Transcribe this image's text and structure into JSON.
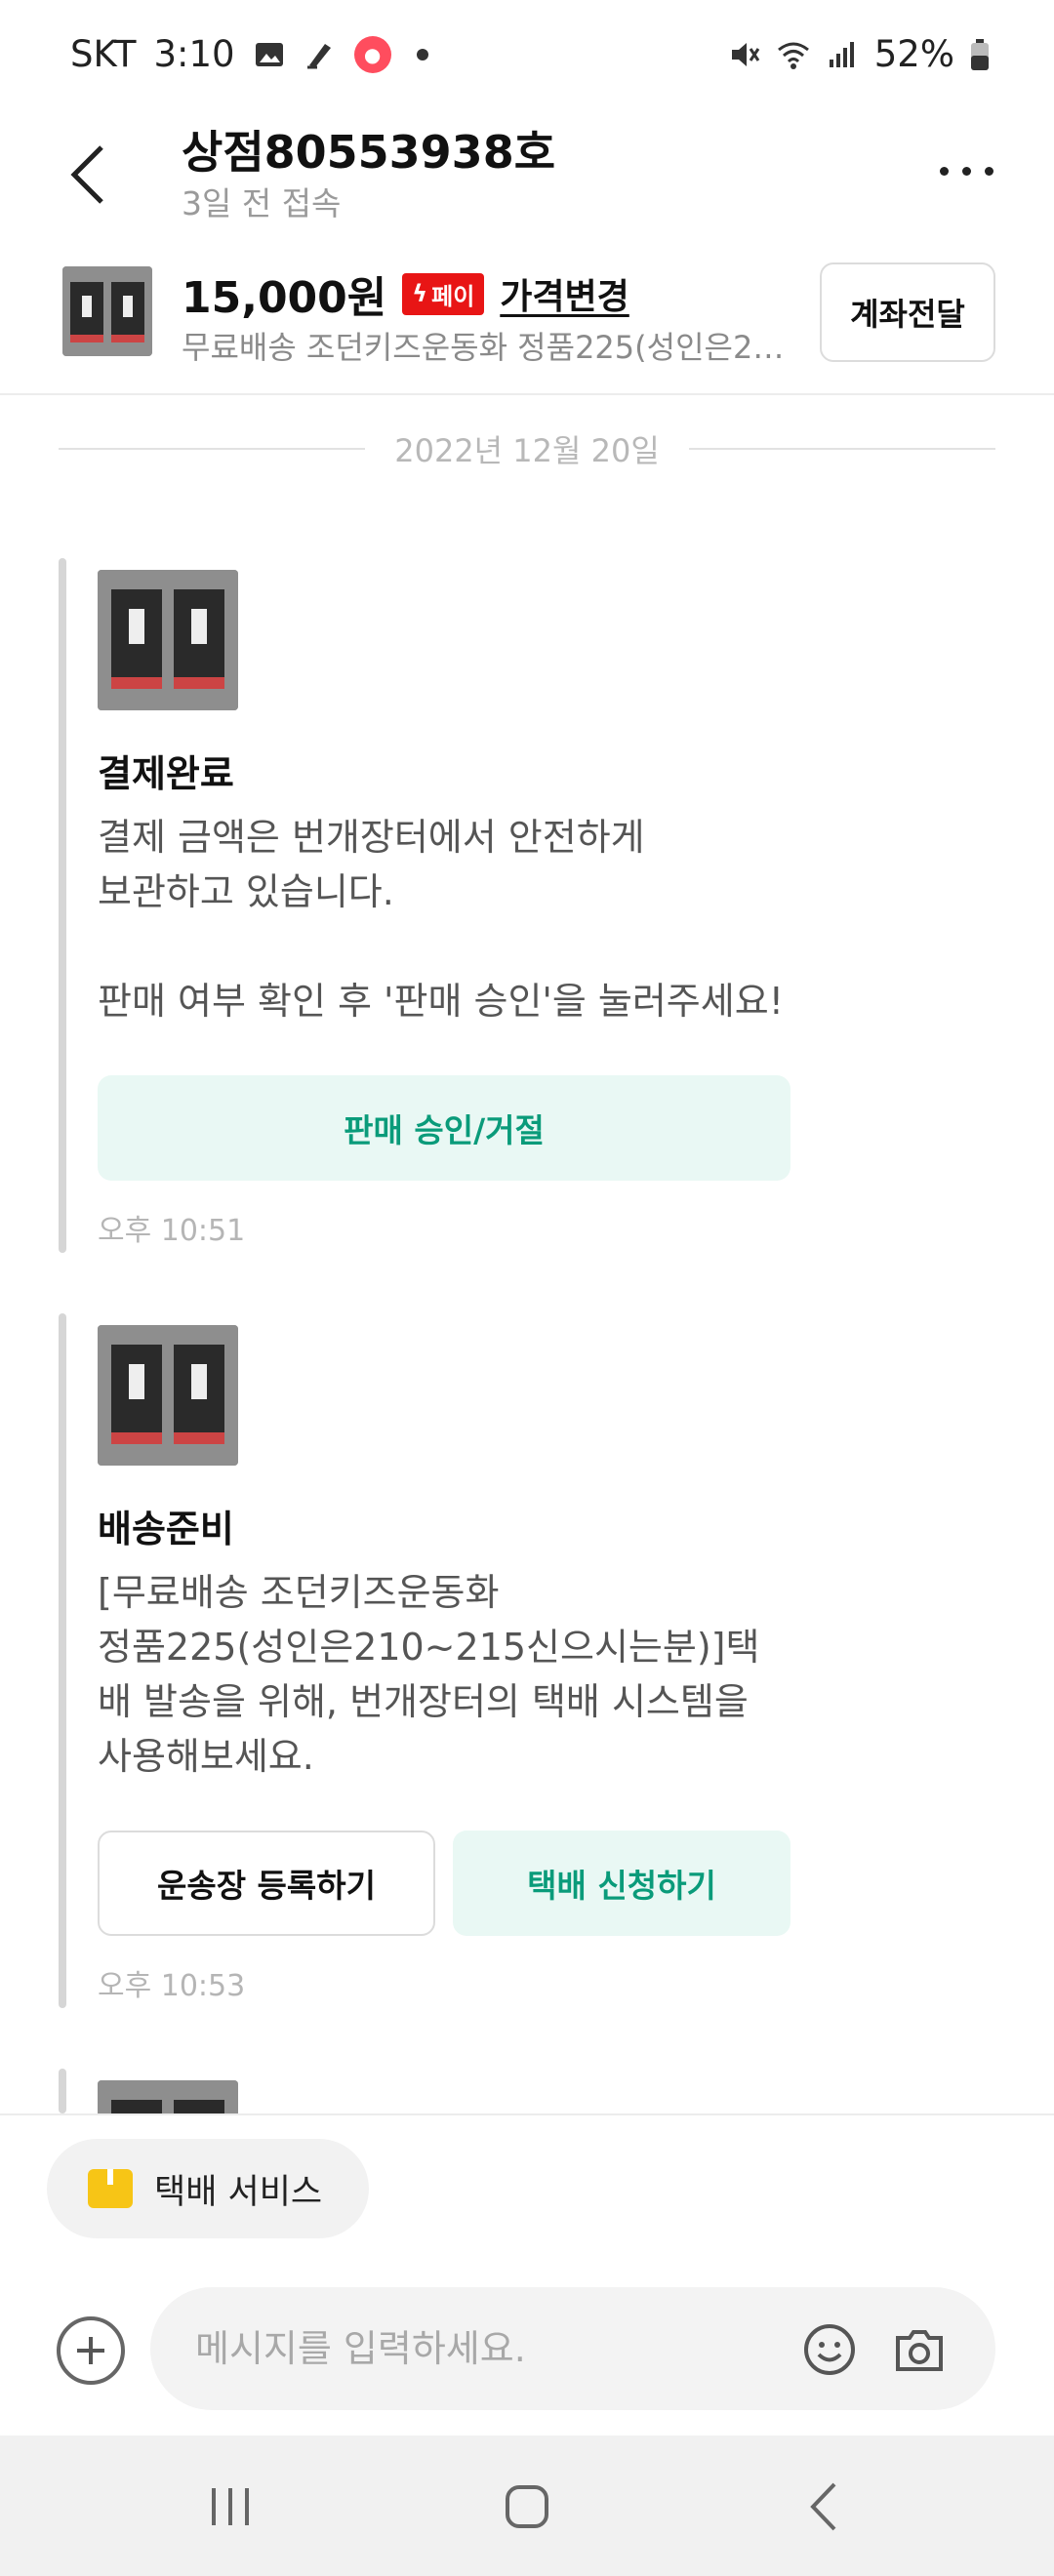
{
  "status_bar": {
    "carrier": "SKT",
    "time": "3:10",
    "battery": "52%",
    "icons": [
      "gallery-icon",
      "signature-icon",
      "paw-icon",
      "mute-icon",
      "wifi-icon",
      "signal-icon",
      "battery-icon"
    ]
  },
  "header": {
    "shop_name": "상점80553938호",
    "last_seen": "3일 전 접속",
    "icons": [
      "back-icon",
      "more-icon"
    ]
  },
  "product": {
    "price": "15,000원",
    "pay_badge": "페이",
    "price_change": "가격변경",
    "title": "무료배송 조던키즈운동화 정품225(성인은210~215신으시는분)",
    "transfer_button": "계좌전달"
  },
  "chat": {
    "date": "2022년 12월 20일",
    "messages": [
      {
        "title": "결제완료",
        "body": "결제 금액은 번개장터에서 안전하게\n보관하고 있습니다.\n\n판매 여부 확인 후 '판매 승인'을 눌러주세요!",
        "button": "판매 승인/거절",
        "time": "오후 10:51"
      },
      {
        "title": "배송준비",
        "body": "[무료배송 조던키즈운동화\n정품225(성인은210~215신으시는분)]택\n배 발송을 위해, 번개장터의 택배 시스템을\n사용해보세요.",
        "button_outline": "운송장 등록하기",
        "button_mint": "택배 신청하기",
        "time": "오후 10:53"
      }
    ]
  },
  "bottom": {
    "delivery_service": "택배 서비스",
    "input_placeholder": "메시지를 입력하세요."
  },
  "colors": {
    "accent_mint": "#0a9b7a",
    "mint_bg": "#e9f8f4",
    "pay_red": "#e81515",
    "delivery_yellow": "#f7c516"
  }
}
